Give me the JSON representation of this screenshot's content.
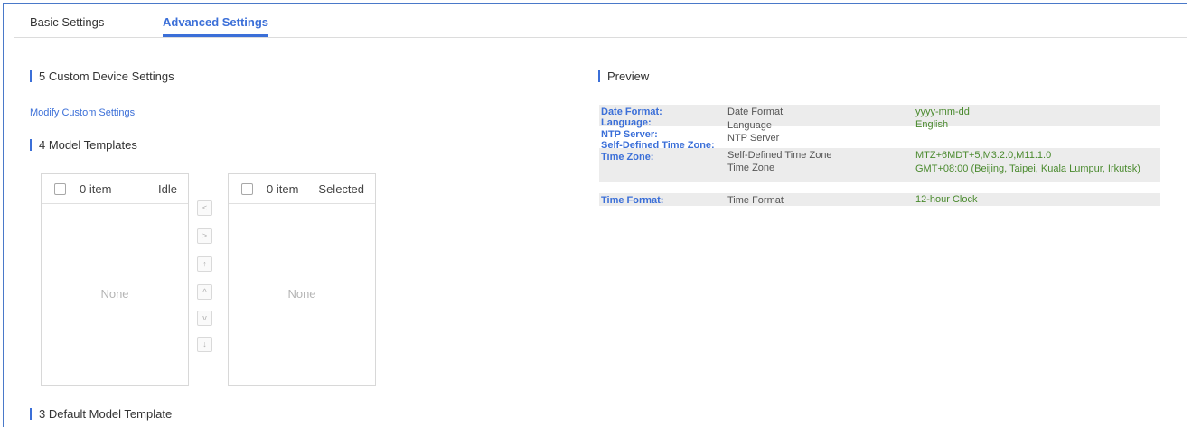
{
  "tabs": [
    {
      "label": "Basic Settings",
      "active": false
    },
    {
      "label": "Advanced Settings",
      "active": true
    }
  ],
  "custom_device": {
    "title": "5 Custom Device Settings",
    "link": "Modify Custom Settings"
  },
  "model_templates": {
    "title": "4 Model Templates",
    "left": {
      "count": "0 item",
      "status": "Idle",
      "empty": "None"
    },
    "right": {
      "count": "0 item",
      "status": "Selected",
      "empty": "None"
    },
    "buttons": [
      {
        "name": "move-left",
        "glyph": "<"
      },
      {
        "name": "move-right",
        "glyph": ">"
      },
      {
        "name": "move-top",
        "glyph": "↑"
      },
      {
        "name": "move-up",
        "glyph": "^"
      },
      {
        "name": "move-down",
        "glyph": "v"
      },
      {
        "name": "move-bottom",
        "glyph": "↓"
      }
    ]
  },
  "default_model": {
    "title": "3 Default Model Template"
  },
  "preview": {
    "title": "Preview",
    "rows": [
      {
        "key": "Date Format:",
        "name": "Date Format",
        "value": "yyyy-mm-dd"
      },
      {
        "key": "Language:",
        "name": "Language",
        "value": "English"
      },
      {
        "key": "NTP Server:",
        "name": "NTP Server",
        "value": ""
      },
      {
        "key": "Self-Defined Time Zone:",
        "name": "Self-Defined Time Zone",
        "value": "MTZ+6MDT+5,M3.2.0,M11.1.0"
      },
      {
        "key": "Time Zone:",
        "name": "Time Zone",
        "value": "GMT+08:00 (Beijing, Taipei, Kuala Lumpur, Irkutsk)"
      },
      {
        "key": "Time Format:",
        "name": "Time Format",
        "value": "12-hour Clock"
      }
    ]
  },
  "colors": {
    "accent": "#3b6fd8",
    "value_green": "#4a8a2e",
    "frame_border": "#4a79c9"
  }
}
